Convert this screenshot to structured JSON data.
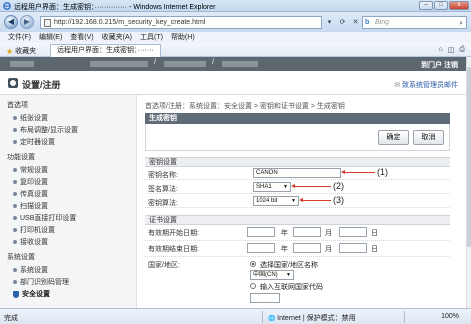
{
  "window": {
    "title": "远程用户界面：生成密钥：·············· - Windows Internet Explorer",
    "minimize": "–",
    "maximize": "□",
    "close": "x"
  },
  "address_bar": {
    "back_icon": "arrow-left-icon",
    "forward_icon": "arrow-right-icon",
    "url": "http://192.168.0.215/m_security_key_create.html",
    "search_placeholder": "Bing",
    "search_logo": "b"
  },
  "menu": [
    "文件(F)",
    "编辑(E)",
    "查看(V)",
    "收藏夹(A)",
    "工具(T)",
    "帮助(H)"
  ],
  "favorites_bar": {
    "favorites_label": "收藏夹",
    "tab_title": "远程用户界面：生成密钥：·······"
  },
  "page_header": {
    "top_right": "到门户  注销",
    "system_title": "设置/注册",
    "mail_link": "致系统管理员邮件"
  },
  "sidebar": {
    "sections": [
      {
        "heading": "首选项",
        "items": [
          "纸张设置",
          "布局调整/显示设置",
          "定时器设置"
        ]
      },
      {
        "heading": "功能设置",
        "items": [
          "常规设置",
          "复印设置",
          "传真设置",
          "扫描设置",
          "USB直接打印设置",
          "打印机设置",
          "接收设置"
        ]
      },
      {
        "heading": "系统设置",
        "items": [
          "系统设置",
          "部门识别码管理",
          "安全设置"
        ]
      }
    ],
    "active_item": "安全设置"
  },
  "main": {
    "breadcrumb": "首选项/注册：系统设置：安全设置 > 密钥和证书设置 > 生成密钥",
    "panel_title": "生成密钥",
    "ok_button": "确定",
    "cancel_button": "取消",
    "key_section": {
      "heading": "密钥设置",
      "key_name_label": "密钥名称:",
      "key_name_value": "CANON",
      "sig_algo_label": "签名算法:",
      "sig_algo_value": "SHA1",
      "key_algo_label": "密钥算法:",
      "key_algo_value": "1024 bit"
    },
    "callouts": [
      "(1)",
      "(2)",
      "(3)"
    ],
    "cert_section": {
      "heading": "证书设置",
      "start_label": "有效期开始日期:",
      "end_label": "有效期结束日期:",
      "year": "年",
      "month": "月",
      "day": "日",
      "country_label": "国家/地区:",
      "radio_select_label": "选择国家/地区名称",
      "country_value": "中国(CN)",
      "radio_internet_label": "输入互联网国家代码"
    }
  },
  "status_bar": {
    "status": "完成",
    "zone": "Internet | 保护模式：禁用",
    "zoom": "100%"
  }
}
